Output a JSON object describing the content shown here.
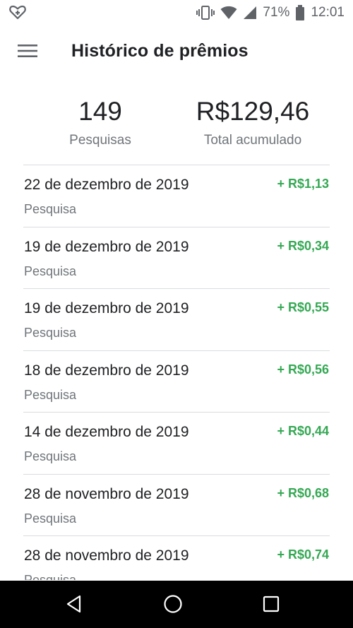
{
  "status_bar": {
    "battery_percent": "71%",
    "time": "12:01",
    "icons": [
      "heart-plus-icon",
      "vibrate-icon",
      "wifi-icon",
      "signal-icon",
      "battery-icon"
    ]
  },
  "header": {
    "title": "Histórico de prêmios",
    "menu_icon": "hamburger-menu-icon"
  },
  "summary": {
    "count_value": "149",
    "count_label": "Pesquisas",
    "total_value": "R$129,46",
    "total_label": "Total acumulado"
  },
  "history": [
    {
      "date": "22 de dezembro de 2019",
      "type": "Pesquisa",
      "amount": "+ R$1,13"
    },
    {
      "date": "19 de dezembro de 2019",
      "type": "Pesquisa",
      "amount": "+ R$0,34"
    },
    {
      "date": "19 de dezembro de 2019",
      "type": "Pesquisa",
      "amount": "+ R$0,55"
    },
    {
      "date": "18 de dezembro de 2019",
      "type": "Pesquisa",
      "amount": "+ R$0,56"
    },
    {
      "date": "14 de dezembro de 2019",
      "type": "Pesquisa",
      "amount": "+ R$0,44"
    },
    {
      "date": "28 de novembro de 2019",
      "type": "Pesquisa",
      "amount": "+ R$0,68"
    },
    {
      "date": "28 de novembro de 2019",
      "type": "Pesquisa",
      "amount": "+ R$0,74"
    }
  ],
  "colors": {
    "amount_green": "#34a853",
    "nav_bar": "#000000",
    "divider": "#dadce0"
  },
  "nav_bar": {
    "icons": [
      "back-icon",
      "home-icon",
      "recents-icon"
    ]
  }
}
